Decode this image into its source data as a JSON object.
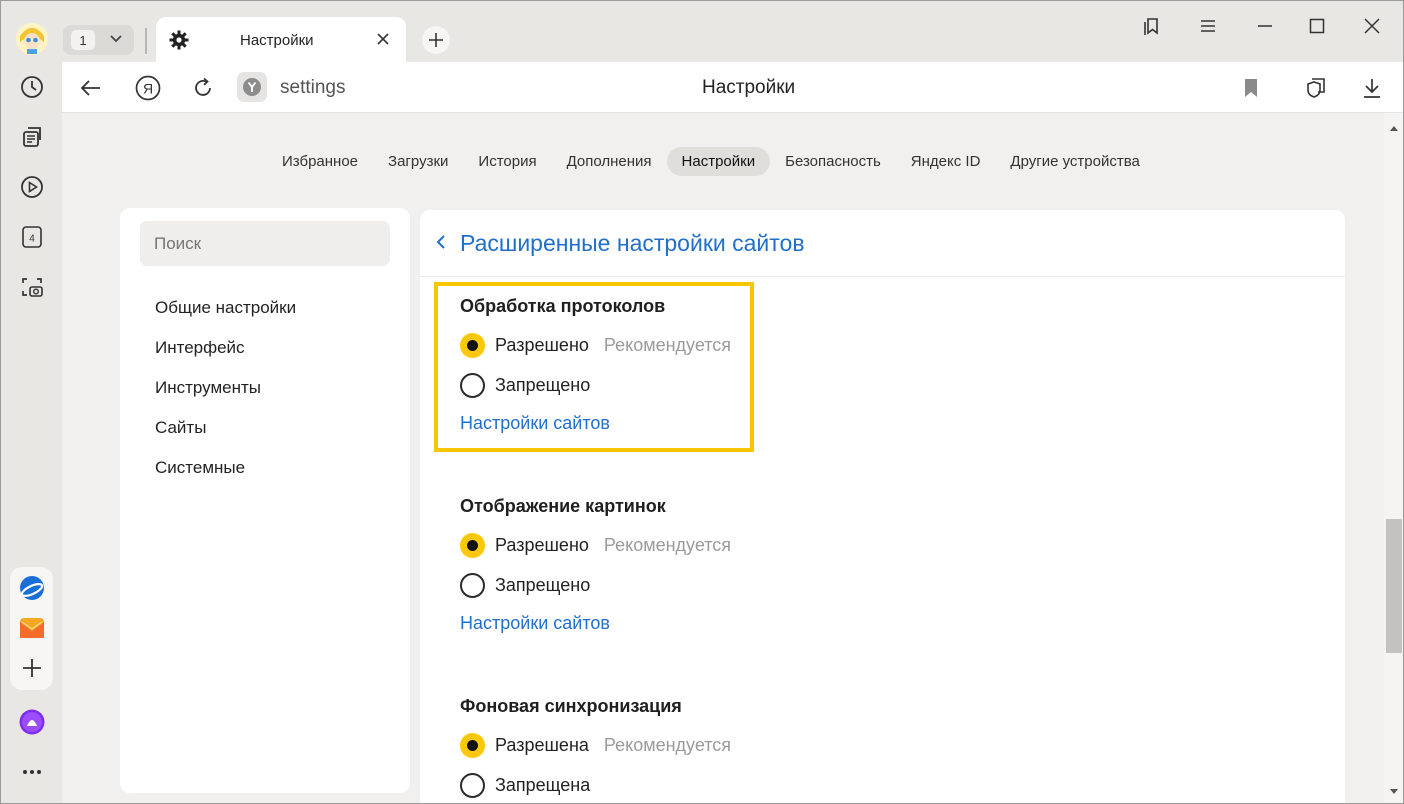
{
  "window": {
    "tab_count": "1",
    "active_tab_title": "Настройки"
  },
  "toolbar": {
    "url": "settings",
    "page_title": "Настройки"
  },
  "nav_tabs": [
    {
      "label": "Избранное",
      "active": false
    },
    {
      "label": "Загрузки",
      "active": false
    },
    {
      "label": "История",
      "active": false
    },
    {
      "label": "Дополнения",
      "active": false
    },
    {
      "label": "Настройки",
      "active": true
    },
    {
      "label": "Безопасность",
      "active": false
    },
    {
      "label": "Яндекс ID",
      "active": false
    },
    {
      "label": "Другие устройства",
      "active": false
    }
  ],
  "left_panel": {
    "search_placeholder": "Поиск",
    "menu": [
      "Общие настройки",
      "Интерфейс",
      "Инструменты",
      "Сайты",
      "Системные"
    ]
  },
  "main": {
    "title": "Расширенные настройки сайтов",
    "sections": [
      {
        "title": "Обработка протоколов",
        "option_allow": "Разрешено",
        "recommended": "Рекомендуется",
        "option_deny": "Запрещено",
        "link": "Настройки сайтов",
        "selected": "allow"
      },
      {
        "title": "Отображение картинок",
        "option_allow": "Разрешено",
        "recommended": "Рекомендуется",
        "option_deny": "Запрещено",
        "link": "Настройки сайтов",
        "selected": "allow"
      },
      {
        "title": "Фоновая синхронизация",
        "option_allow": "Разрешена",
        "recommended": "Рекомендуется",
        "option_deny": "Запрещена",
        "selected": "allow"
      }
    ]
  },
  "sidebar_icons": [
    "history-icon",
    "collections-icon",
    "video-play-icon",
    "tab-group-icon",
    "screenshot-icon",
    "disk-icon",
    "mail-icon",
    "add-icon",
    "alice-icon",
    "more-icon"
  ],
  "colors": {
    "accent_yellow": "#fdc80c",
    "link_blue": "#1f6fcb",
    "highlight_border": "#f7c600"
  }
}
